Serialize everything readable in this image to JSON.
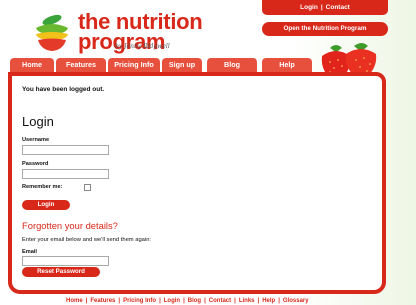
{
  "brand": {
    "line1": "the nutrition",
    "line2": "program",
    "byline": "by Jenny Ridgwell",
    "colors": {
      "red": "#d8281a",
      "tab": "#e8503e"
    }
  },
  "header": {
    "top_links": [
      "Login",
      "Contact"
    ],
    "open_button": "Open the Nutrition Program"
  },
  "nav": {
    "tabs": [
      {
        "label": "Home"
      },
      {
        "label": "Features"
      },
      {
        "label": "Pricing Info"
      },
      {
        "label": "Sign up"
      },
      {
        "label": "Blog"
      },
      {
        "label": "Help"
      }
    ]
  },
  "main": {
    "message": "You have been logged out.",
    "login_heading": "Login",
    "username_label": "Username",
    "username_value": "",
    "password_label": "Password",
    "password_value": "",
    "remember_label": "Remember me:",
    "remember_checked": false,
    "login_button": "Login",
    "forgot_heading": "Forgotten your details?",
    "forgot_text": "Enter your email below and we'll send them again:",
    "email_label": "Email",
    "email_value": "",
    "reset_button": "Reset Password"
  },
  "footer": {
    "links": [
      "Home",
      "Features",
      "Pricing Info",
      "Login",
      "Blog",
      "Contact",
      "Links",
      "Help",
      "Glossary"
    ]
  }
}
